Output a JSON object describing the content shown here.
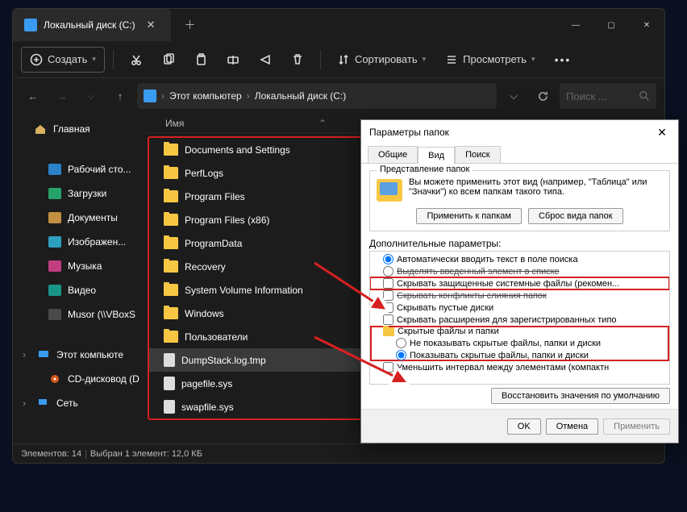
{
  "tab_title": "Локальный диск (C:)",
  "toolbar": {
    "create": "Создать",
    "sort": "Сортировать",
    "view": "Просмотреть"
  },
  "breadcrumb": {
    "root": "Этот компьютер",
    "curr": "Локальный диск (C:)"
  },
  "search": {
    "placeholder": "Поиск ..."
  },
  "sidebar": {
    "home": "Главная",
    "items": [
      "Рабочий сто...",
      "Загрузки",
      "Документы",
      "Изображен...",
      "Музыка",
      "Видео",
      "Musor (\\\\VBoxS"
    ],
    "pc": "Этот компьюте",
    "cd": "CD-дисковод (D",
    "net": "Сеть"
  },
  "col": {
    "name": "Имя"
  },
  "files": [
    "Documents and Settings",
    "PerfLogs",
    "Program Files",
    "Program Files (x86)",
    "ProgramData",
    "Recovery",
    "System Volume Information",
    "Windows",
    "Пользователи",
    "DumpStack.log.tmp",
    "pagefile.sys",
    "swapfile.sys"
  ],
  "sel_index": 9,
  "status": {
    "count": "Элементов: 14",
    "sel": "Выбран 1 элемент: 12,0 КБ"
  },
  "dialog": {
    "title": "Параметры папок",
    "tabs": [
      "Общие",
      "Вид",
      "Поиск"
    ],
    "group1_title": "Представление папок",
    "preview_text": "Вы можете применить этот вид (например, \"Таблица\" или \"Значки\") ко всем папкам такого типа.",
    "apply_btn": "Применить к папкам",
    "reset_btn": "Сброс вида папок",
    "group2_title": "Дополнительные параметры:",
    "opts": [
      {
        "t": "radio",
        "c": true,
        "l": "Автоматически вводить текст в поле поиска"
      },
      {
        "t": "radio",
        "c": false,
        "l": "Выделять введенный элемент в списке",
        "skip": true
      },
      {
        "t": "check",
        "c": false,
        "l": "Скрывать защищенные системные файлы (рекомен...",
        "red": true
      },
      {
        "t": "check",
        "c": false,
        "l": "Скрывать конфликты слияния папок",
        "skip": true
      },
      {
        "t": "check",
        "c": false,
        "l": "Скрывать пустые диски"
      },
      {
        "t": "check",
        "c": false,
        "l": "Скрывать расширения для зарегистрированных типо"
      },
      {
        "t": "folder",
        "l": "Скрытые файлы и папки",
        "redstart": true
      },
      {
        "t": "radio",
        "c": false,
        "l": "Не показывать скрытые файлы, папки и диски",
        "lvl": 1
      },
      {
        "t": "radio",
        "c": true,
        "l": "Показывать скрытые файлы, папки и диски",
        "lvl": 1,
        "redend": true
      },
      {
        "t": "check",
        "c": false,
        "l": "Уменьшить интервал между элементами (компактн"
      }
    ],
    "restore": "Восстановить значения по умолчанию",
    "ok": "OK",
    "cancel": "Отмена",
    "apply": "Применить"
  }
}
